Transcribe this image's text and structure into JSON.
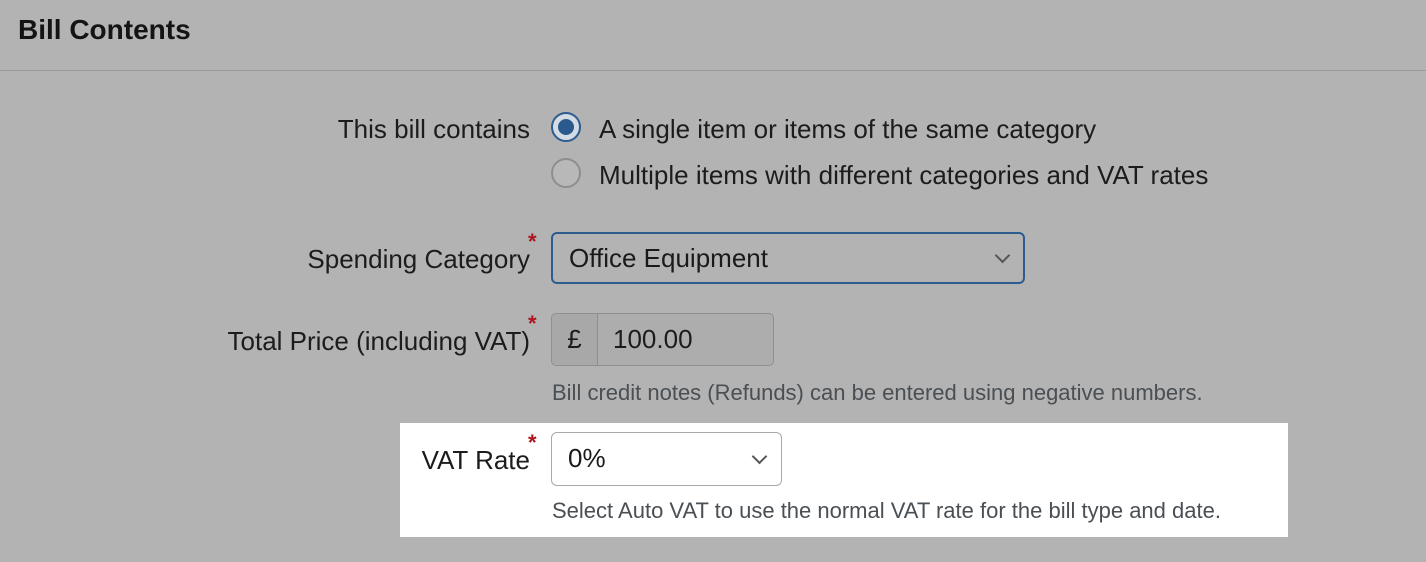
{
  "header": {
    "title": "Bill Contents"
  },
  "bill_contains": {
    "label": "This bill contains",
    "options": [
      {
        "label": "A single item or items of the same category",
        "checked": true
      },
      {
        "label": "Multiple items with different categories and VAT rates",
        "checked": false
      }
    ]
  },
  "spending_category": {
    "label": "Spending Category",
    "required_marker": "*",
    "value": "Office Equipment"
  },
  "total_price": {
    "label": "Total Price (including VAT)",
    "required_marker": "*",
    "currency": "£",
    "value": "100.00",
    "help": "Bill credit notes (Refunds) can be entered using negative numbers."
  },
  "vat_rate": {
    "label": "VAT Rate",
    "required_marker": "*",
    "value": "0%",
    "help": "Select Auto VAT to use the normal VAT rate for the bill type and date."
  },
  "colors": {
    "accent": "#2d5c8e",
    "required": "#b0141c",
    "overlay": "#b3b3b3",
    "highlight": "#ffffff"
  }
}
